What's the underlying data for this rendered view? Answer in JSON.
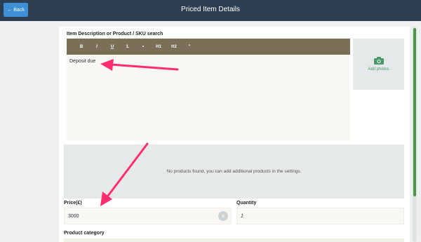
{
  "header": {
    "back_label": "Back",
    "title": "Priced Item Details"
  },
  "form": {
    "description_label": "Item Description or Product / SKU search",
    "toolbar": [
      "B",
      "I",
      "U",
      "1.",
      "•",
      "H1",
      "H2",
      "”"
    ],
    "description_value": "Deposit due",
    "add_photos_label": "Add photos",
    "products_message": "No products found, you can add additional products in the settings.",
    "price_label": "Price(£)",
    "price_value": "3000",
    "quantity_label": "Quantity",
    "quantity_value": "1",
    "category_label": "Product category"
  },
  "colors": {
    "header_bg": "#2c3e50",
    "back_button": "#3d8fd6",
    "toolbar_bg": "#7a7058",
    "annotation_arrow": "#ff2d6f",
    "scrollbar": "#4a9a4a"
  },
  "icons": {
    "back": "arrow-left-icon",
    "photo": "camera-icon",
    "clear": "close-icon"
  }
}
